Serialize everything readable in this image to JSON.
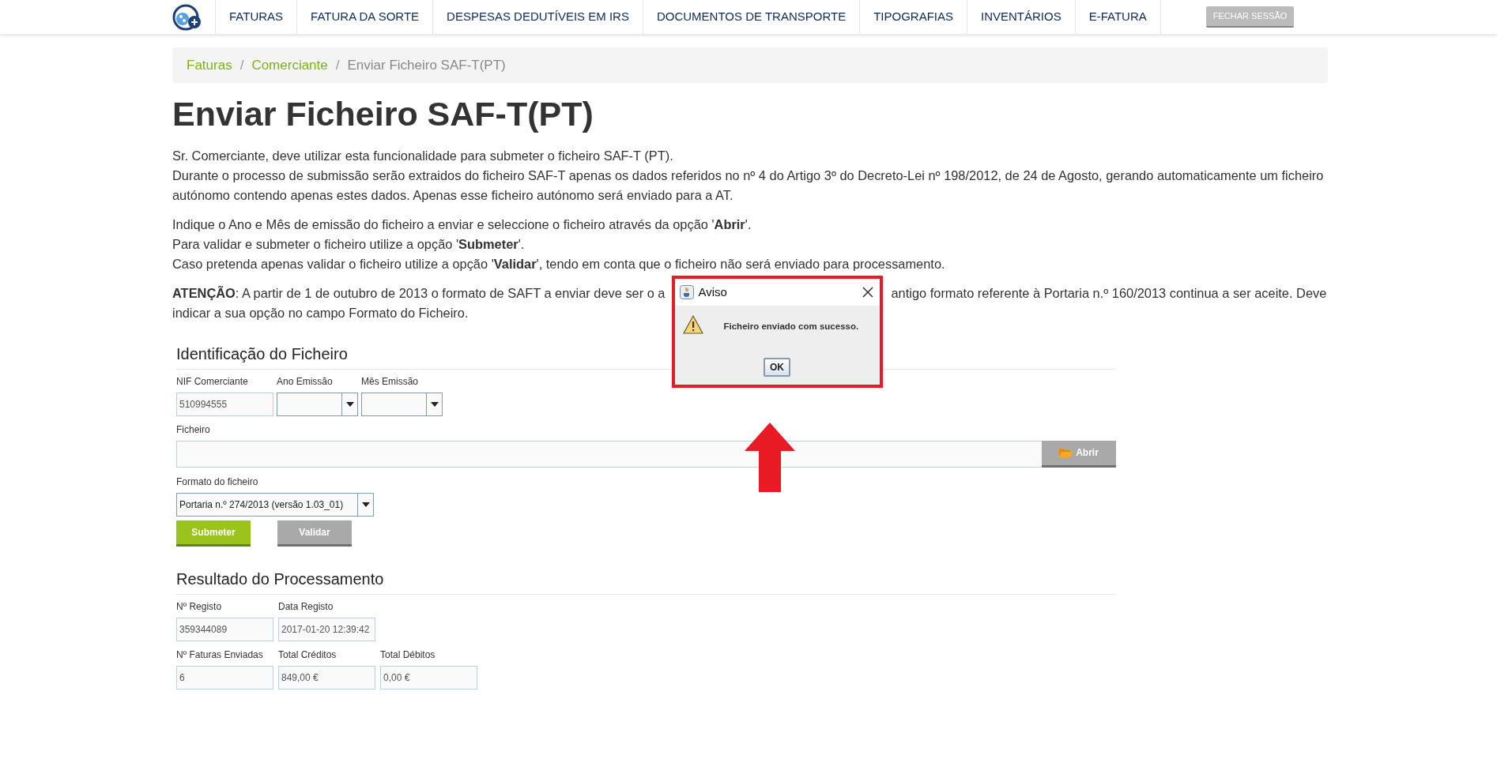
{
  "navbar": {
    "items": [
      {
        "label": "FATURAS"
      },
      {
        "label": "FATURA DA SORTE"
      },
      {
        "label": "DESPESAS DEDUTÍVEIS EM IRS"
      },
      {
        "label": "DOCUMENTOS DE TRANSPORTE"
      },
      {
        "label": "TIPOGRAFIAS"
      },
      {
        "label": "INVENTÁRIOS"
      },
      {
        "label": "E-FATURA"
      }
    ],
    "logout_button": "FECHAR SESSÃO"
  },
  "breadcrumb": [
    {
      "kind": "link",
      "text": "Faturas"
    },
    {
      "kind": "separator",
      "text": "/"
    },
    {
      "kind": "link",
      "text": "Comerciante"
    },
    {
      "kind": "separator",
      "text": "/"
    },
    {
      "kind": "current",
      "text": "Enviar Ficheiro SAF-T(PT)"
    }
  ],
  "title": "Enviar Ficheiro SAF-T(PT)",
  "paragraphs": [
    {
      "lines": [
        "Sr. Comerciante, deve utilizar esta funcionalidade para submeter o ficheiro SAF-T (PT).",
        "Durante o processo de submissão serão extraidos do ficheiro SAF-T apenas os dados referidos no nº 4 do Artigo 3º do Decreto-Lei nº 198/2012, de 24 de Agosto, gerando automaticamente um ficheiro",
        "autónomo contendo apenas estes dados. Apenas esse ficheiro autónomo será enviado para a AT."
      ]
    },
    {
      "lines": [
        "Indique o Ano e Mês de emissão do ficheiro a enviar e seleccione o ficheiro através da opção '**Abrir**'.",
        "Para validar e submeter o ficheiro utilize a opção '**Submeter**'.",
        "Caso pretenda apenas validar o ficheiro utilize a opção '**Validar**', tendo em conta que o ficheiro não será enviado para processamento."
      ]
    }
  ],
  "notice": {
    "before": "**ATENÇÃO**: A partir de 1 de outubro de 2013 o formato de SAFT a enviar deve ser o a",
    "after": "antigo formato referente à Portaria n.º 160/2013 continua a ser aceite. Deve",
    "line_2": "indicar a sua opção no campo Formato do Ficheiro."
  },
  "identification": {
    "title": "Identificação do Ficheiro",
    "row_1": [
      {
        "kind": "text",
        "label": "NIF Comerciante",
        "value": "510994555"
      },
      {
        "kind": "select",
        "label": "Ano Emissão"
      },
      {
        "kind": "select",
        "label": "Mês Emissão"
      }
    ],
    "file": {
      "label": "Ficheiro",
      "button": "Abrir"
    },
    "format": {
      "label": "Formato do ficheiro",
      "value": "Portaria n.º 274/2013 (versão 1.03_01)"
    },
    "buttons": [
      {
        "kind": "primary",
        "label": "Submeter"
      },
      {
        "kind": "secondary",
        "label": "Validar"
      }
    ]
  },
  "results": {
    "title": "Resultado do Processamento",
    "rows": [
      [
        {
          "label": "Nº Registo",
          "value": "359344089"
        },
        {
          "label": "Data Registo",
          "value": "2017-01-20 12:39:42"
        }
      ],
      [
        {
          "label": "Nº Faturas Enviadas",
          "value": "6"
        },
        {
          "label": "Total Créditos",
          "value": "849,00 €"
        },
        {
          "label": "Total Débitos",
          "value": "0,00 €"
        }
      ]
    ]
  },
  "dialog": {
    "title": "Aviso",
    "message": "Ficheiro enviado com sucesso.",
    "button": "OK"
  }
}
